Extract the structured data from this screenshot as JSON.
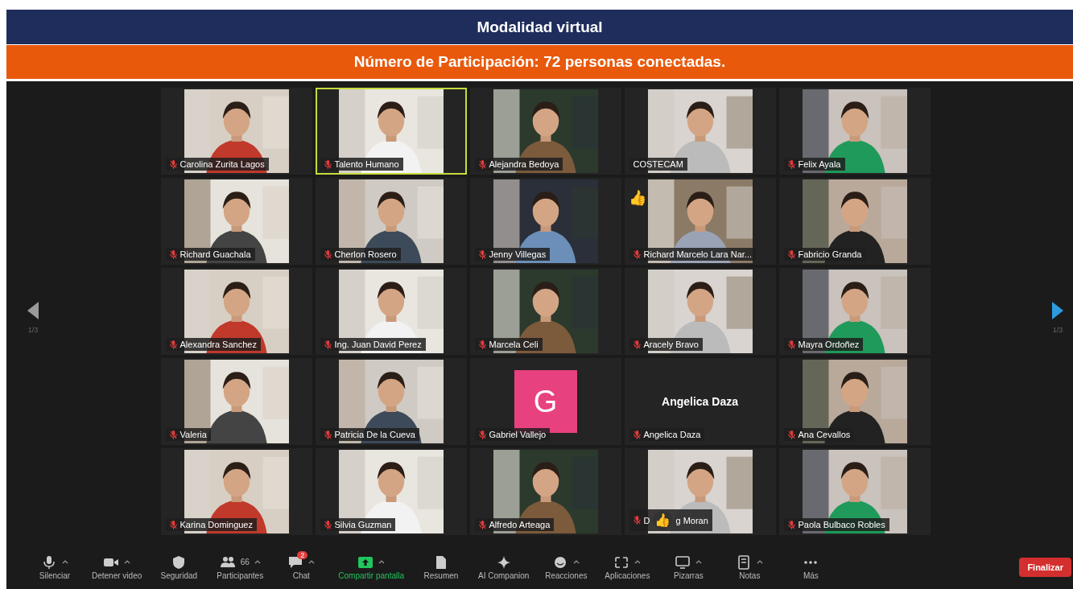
{
  "header": {
    "title": "Modalidad virtual",
    "subtitle": "Número de Participación: 72 personas conectadas."
  },
  "meeting": {
    "page_left": "1/3",
    "page_right": "1/3",
    "tiles": [
      {
        "kind": "video",
        "name": "Carolina Zurita Lagos",
        "muted": true,
        "selected": false
      },
      {
        "kind": "video",
        "name": "Talento Humano",
        "muted": true,
        "selected": true
      },
      {
        "kind": "video",
        "name": "Alejandra Bedoya",
        "muted": true,
        "selected": false
      },
      {
        "kind": "video",
        "name": "COSTECAM",
        "muted": false,
        "selected": false
      },
      {
        "kind": "video",
        "name": "Felix Ayala",
        "muted": true,
        "selected": false
      },
      {
        "kind": "video",
        "name": "Richard Guachala",
        "muted": true,
        "selected": false
      },
      {
        "kind": "video",
        "name": "Cherlon Rosero",
        "muted": true,
        "selected": false
      },
      {
        "kind": "video",
        "name": "Jenny Villegas",
        "muted": true,
        "selected": false
      },
      {
        "kind": "video",
        "name": "Richard Marcelo Lara Nar...",
        "muted": true,
        "selected": false,
        "reaction": "👍"
      },
      {
        "kind": "video",
        "name": "Fabricio Granda",
        "muted": true,
        "selected": false
      },
      {
        "kind": "video",
        "name": "Alexandra Sanchez",
        "muted": true,
        "selected": false
      },
      {
        "kind": "video",
        "name": "Ing. Juan David Perez",
        "muted": true,
        "selected": false
      },
      {
        "kind": "video",
        "name": "Marcela Celi",
        "muted": true,
        "selected": false
      },
      {
        "kind": "video",
        "name": "Aracely Bravo",
        "muted": true,
        "selected": false
      },
      {
        "kind": "video",
        "name": "Mayra Ordoñez",
        "muted": true,
        "selected": false
      },
      {
        "kind": "video",
        "name": "Valeria",
        "muted": true,
        "selected": false
      },
      {
        "kind": "video",
        "name": "Patricia De la Cueva",
        "muted": true,
        "selected": false
      },
      {
        "kind": "avatar",
        "name": "Gabriel Vallejo",
        "muted": true,
        "selected": false,
        "initial": "G",
        "color": "#e8417f"
      },
      {
        "kind": "name",
        "name": "Angelica Daza",
        "muted": true,
        "selected": false,
        "display": "Angelica Daza"
      },
      {
        "kind": "video",
        "name": "Ana Cevallos",
        "muted": true,
        "selected": false
      },
      {
        "kind": "video",
        "name": "Karina Dominguez",
        "muted": true,
        "selected": false
      },
      {
        "kind": "video",
        "name": "Silvia Guzman",
        "muted": true,
        "selected": false
      },
      {
        "kind": "video",
        "name": "Alfredo Arteaga",
        "muted": true,
        "selected": false
      },
      {
        "kind": "video",
        "name": "D",
        "name_rest": "g Moran",
        "muted": true,
        "selected": false,
        "overlay": "👍"
      },
      {
        "kind": "video",
        "name": "Paola Bulbaco Robles",
        "muted": true,
        "selected": false
      }
    ]
  },
  "toolbar": {
    "items": [
      {
        "kind": "mic",
        "label": "Silenciar",
        "caret": true
      },
      {
        "kind": "camera",
        "label": "Detener video",
        "caret": true
      },
      {
        "kind": "shield",
        "label": "Seguridad"
      },
      {
        "kind": "people",
        "label": "Participantes",
        "caret": true,
        "count": "66"
      },
      {
        "kind": "chat",
        "label": "Chat",
        "caret": true,
        "badge": "2"
      },
      {
        "kind": "share",
        "label": "Compartir pantalla",
        "caret": true
      },
      {
        "kind": "doc",
        "label": "Resumen"
      },
      {
        "kind": "sparkle",
        "label": "AI Companion"
      },
      {
        "kind": "smile",
        "label": "Reacciones",
        "caret": true
      },
      {
        "kind": "apps",
        "label": "Aplicaciones",
        "caret": true
      },
      {
        "kind": "board",
        "label": "Pizarras",
        "caret": true
      },
      {
        "kind": "notes",
        "label": "Notas",
        "caret": true
      },
      {
        "kind": "more",
        "label": "Más"
      }
    ],
    "end_button": "Finalizar"
  }
}
